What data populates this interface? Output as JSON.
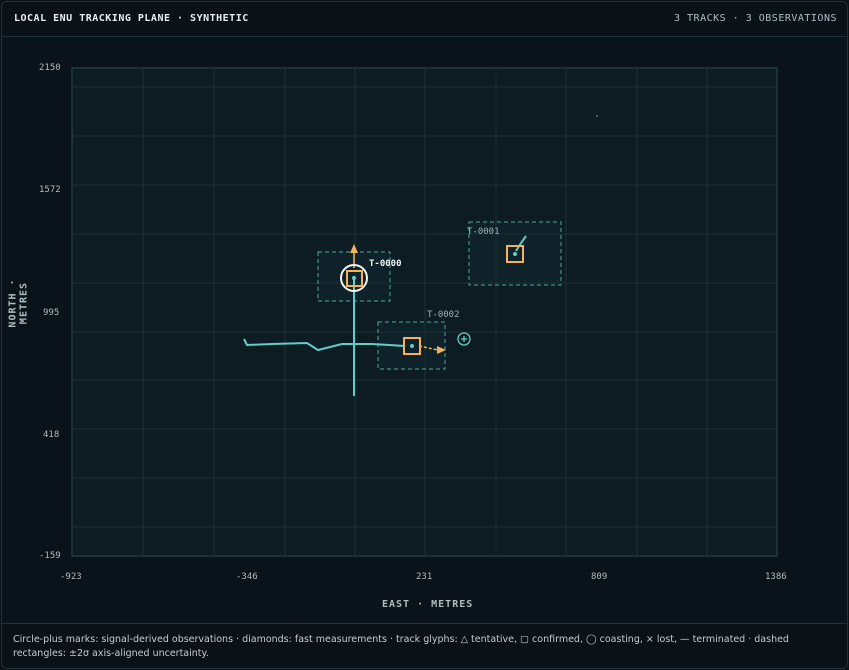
{
  "header": {
    "title": "LOCAL ENU TRACKING PLANE · SYNTHETIC",
    "summary": "3 TRACKS · 3 OBSERVATIONS"
  },
  "axes": {
    "xlabel": "EAST · METRES",
    "ylabel": "NORTH · METRES",
    "x_ticks": [
      "-923",
      "-346",
      "231",
      "809",
      "1386"
    ],
    "y_ticks": [
      "2150",
      "1572",
      "995",
      "418",
      "-159"
    ]
  },
  "tracks": [
    {
      "id": "T-0000",
      "status": "confirmed",
      "selected": true
    },
    {
      "id": "T-0001",
      "status": "confirmed",
      "selected": false
    },
    {
      "id": "T-0002",
      "status": "confirmed",
      "selected": false
    }
  ],
  "footer": {
    "legend": "Circle-plus marks: signal-derived observations · diamonds: fast measurements · track glyphs: △ tentative, ▢ confirmed, ◯ coasting, × lost, — terminated · dashed rectangles: ±2σ axis-aligned uncertainty."
  },
  "colors": {
    "background": "#0b131a",
    "plot_bg": "#0d1b22",
    "grid": "#1f3038",
    "track_trail": "#5fd0c8",
    "track_glyph": "#f2b35a",
    "uncertainty": "#4aa89e",
    "label": "#c9d6dc"
  }
}
